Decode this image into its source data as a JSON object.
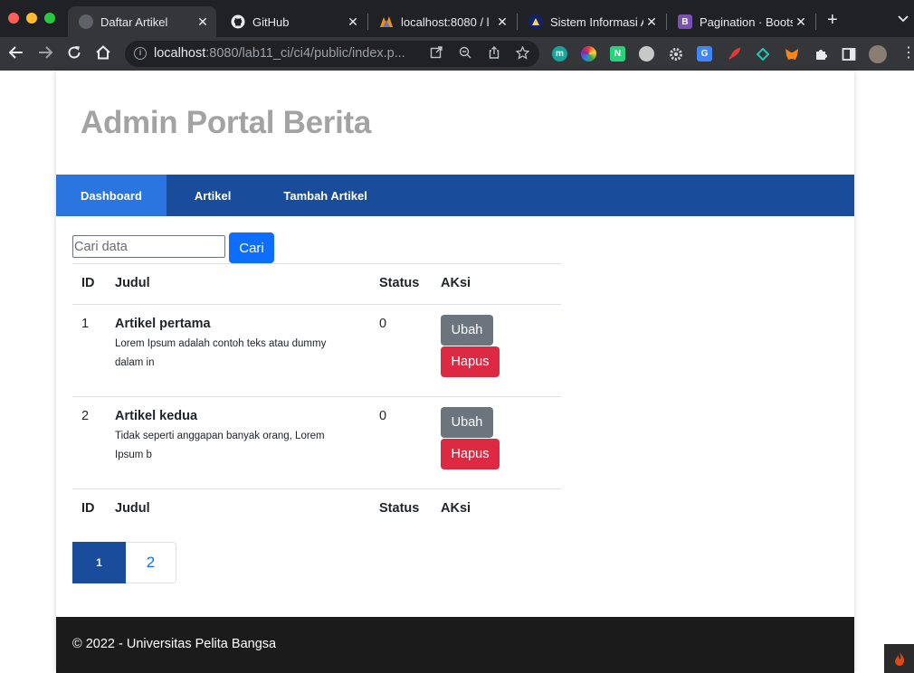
{
  "browser": {
    "tabs": [
      {
        "title": "Daftar Artikel",
        "favicon": "site-icon",
        "active": true
      },
      {
        "title": "GitHub",
        "favicon": "github-icon",
        "active": false
      },
      {
        "title": "localhost:8080 / l",
        "favicon": "phpmyadmin-icon",
        "active": false
      },
      {
        "title": "Sistem Informasi A",
        "favicon": "university-icon",
        "active": false
      },
      {
        "title": "Pagination · Boots",
        "favicon": "bootstrap-icon",
        "active": false
      }
    ],
    "url_host": "localhost",
    "url_path": ":8080/lab11_ci/ci4/public/index.p..."
  },
  "site": {
    "title": "Admin Portal Berita",
    "nav": [
      {
        "label": "Dashboard",
        "active": true
      },
      {
        "label": "Artikel",
        "active": false
      },
      {
        "label": "Tambah Artikel",
        "active": false
      }
    ]
  },
  "search": {
    "placeholder": "Cari data",
    "button_label": "Cari"
  },
  "table": {
    "headers": [
      "ID",
      "Judul",
      "Status",
      "AKsi"
    ],
    "rows": [
      {
        "id": "1",
        "title": "Artikel pertama",
        "desc": "Lorem Ipsum adalah contoh teks atau dummy dalam in",
        "status": "0",
        "edit_label": "Ubah",
        "delete_label": "Hapus"
      },
      {
        "id": "2",
        "title": "Artikel kedua",
        "desc": "Tidak seperti anggapan banyak orang, Lorem Ipsum b",
        "status": "0",
        "edit_label": "Ubah",
        "delete_label": "Hapus"
      }
    ]
  },
  "pagination": {
    "pages": [
      "1",
      "2"
    ],
    "current": "1"
  },
  "footer": {
    "text": "© 2022 - Universitas Pelita Bangsa"
  },
  "colors": {
    "navbar": "#1a4c9c",
    "nav_active": "#2a75e0",
    "primary": "#0d6efd",
    "secondary": "#6c757d",
    "danger": "#dc2a43",
    "footer": "#1b1b1b"
  }
}
